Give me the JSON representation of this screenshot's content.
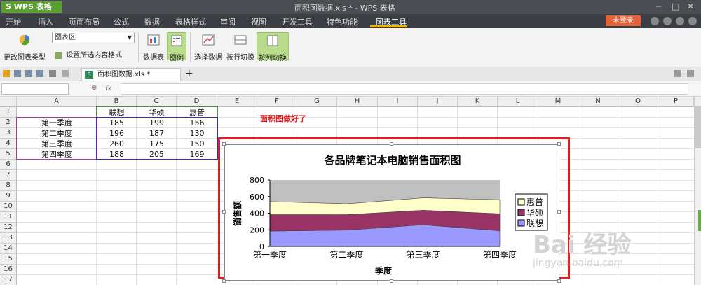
{
  "app": {
    "logo": "S WPS 表格",
    "window_title": "面积图数据.xls * - WPS 表格",
    "login_label": "未登录",
    "window_controls": [
      "─",
      "□",
      "✕"
    ]
  },
  "menu": [
    "开始",
    "插入",
    "页面布局",
    "公式",
    "数据",
    "表格样式",
    "审阅",
    "视图",
    "开发工具",
    "特色功能",
    "图表工具"
  ],
  "ribbon": {
    "change_type": "更改图表类型",
    "element_select": "图表区",
    "format_selection": "设置所选内容格式",
    "data_table": "数据表",
    "legend": "图例",
    "select_data": "选择数据",
    "switch_row": "按行切换",
    "switch_col": "按列切换"
  },
  "tabs": {
    "file_tab": "面积图数据.xls *",
    "close": "×",
    "add": "+"
  },
  "formula": {
    "fx": "fx",
    "zoom": "⊕"
  },
  "grid": {
    "columns": [
      "A",
      "B",
      "C",
      "D",
      "E",
      "F",
      "G",
      "H",
      "I",
      "J",
      "K",
      "L",
      "M",
      "N",
      "O",
      "P"
    ],
    "rows": [
      "1",
      "2",
      "3",
      "4",
      "5",
      "6",
      "7",
      "8",
      "9",
      "10",
      "11",
      "12",
      "13",
      "14",
      "15",
      "16",
      "17"
    ],
    "headers": [
      "联想",
      "华硕",
      "惠普"
    ],
    "row_labels": [
      "第一季度",
      "第二季度",
      "第三季度",
      "第四季度"
    ],
    "values": [
      [
        "185",
        "199",
        "156"
      ],
      [
        "196",
        "187",
        "130"
      ],
      [
        "260",
        "175",
        "150"
      ],
      [
        "188",
        "205",
        "169"
      ]
    ]
  },
  "annotation": "面积图做好了",
  "chart_data": {
    "type": "area",
    "stacked": true,
    "title": "各品牌笔记本电脑销售面积图",
    "xlabel": "季度",
    "ylabel": "销售额",
    "categories": [
      "第一季度",
      "第二季度",
      "第三季度",
      "第四季度"
    ],
    "yticks": [
      "0",
      "200",
      "400",
      "600",
      "800"
    ],
    "ylim": [
      0,
      800
    ],
    "grid": "horizontal",
    "legend_position": "right",
    "series": [
      {
        "name": "联想",
        "values": [
          185,
          196,
          260,
          188
        ],
        "color": "#9999ff"
      },
      {
        "name": "华硕",
        "values": [
          199,
          187,
          175,
          205
        ],
        "color": "#993366"
      },
      {
        "name": "惠普",
        "values": [
          156,
          130,
          150,
          169
        ],
        "color": "#ffffcc"
      }
    ],
    "plot_area_color": "#c0c0c0"
  },
  "watermark": {
    "big": "Bai 经验",
    "small": "jingyan.baidu.com"
  },
  "colors": {
    "accent": "#5aa02c",
    "annotation_red": "#e02020",
    "menu_bg": "#3b3e42",
    "active_underline": "#f0b400"
  }
}
